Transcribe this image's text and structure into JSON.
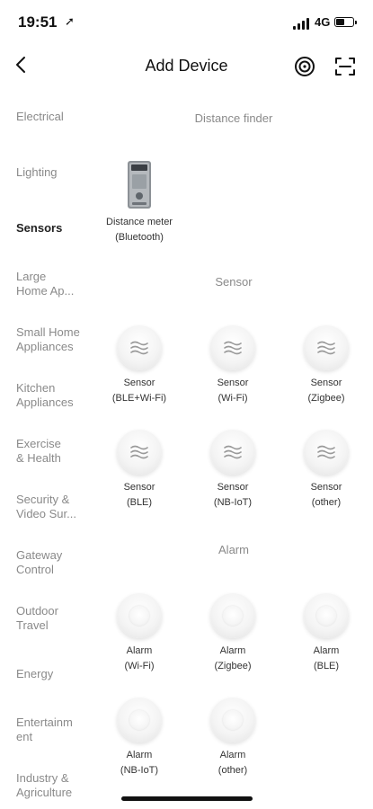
{
  "status_bar": {
    "time": "19:51",
    "network": "4G"
  },
  "header": {
    "title": "Add Device"
  },
  "sidebar": {
    "items": [
      {
        "line1": "Electrical",
        "line2": "",
        "active": false
      },
      {
        "line1": "Lighting",
        "line2": "",
        "active": false
      },
      {
        "line1": "Sensors",
        "line2": "",
        "active": true
      },
      {
        "line1": "Large",
        "line2": "Home Ap...",
        "active": false
      },
      {
        "line1": "Small Home",
        "line2": "Appliances",
        "active": false
      },
      {
        "line1": "Kitchen",
        "line2": "Appliances",
        "active": false
      },
      {
        "line1": "Exercise",
        "line2": "& Health",
        "active": false
      },
      {
        "line1": "Security &",
        "line2": "Video Sur...",
        "active": false
      },
      {
        "line1": "Gateway",
        "line2": "Control",
        "active": false
      },
      {
        "line1": "Outdoor",
        "line2": "Travel",
        "active": false
      },
      {
        "line1": "Energy",
        "line2": "",
        "active": false
      },
      {
        "line1": "Entertainm",
        "line2": "ent",
        "active": false
      },
      {
        "line1": "Industry &",
        "line2": "Agriculture",
        "active": false
      }
    ]
  },
  "sections": {
    "distance": {
      "title": "Distance finder",
      "items": [
        {
          "line1": "Distance meter",
          "line2": "(Bluetooth)",
          "icon": "distance-meter-device"
        }
      ]
    },
    "sensor": {
      "title": "Sensor",
      "items": [
        {
          "line1": "Sensor",
          "line2": "(BLE+Wi-Fi)",
          "icon": "wave-sensor"
        },
        {
          "line1": "Sensor",
          "line2": "(Wi-Fi)",
          "icon": "wave-sensor"
        },
        {
          "line1": "Sensor",
          "line2": "(Zigbee)",
          "icon": "wave-sensor"
        },
        {
          "line1": "Sensor",
          "line2": "(BLE)",
          "icon": "wave-sensor"
        },
        {
          "line1": "Sensor",
          "line2": "(NB-IoT)",
          "icon": "wave-sensor"
        },
        {
          "line1": "Sensor",
          "line2": "(other)",
          "icon": "wave-sensor"
        }
      ]
    },
    "alarm": {
      "title": "Alarm",
      "items": [
        {
          "line1": "Alarm",
          "line2": "(Wi-Fi)",
          "icon": "alarm-puck"
        },
        {
          "line1": "Alarm",
          "line2": "(Zigbee)",
          "icon": "alarm-puck"
        },
        {
          "line1": "Alarm",
          "line2": "(BLE)",
          "icon": "alarm-puck"
        },
        {
          "line1": "Alarm",
          "line2": "(NB-IoT)",
          "icon": "alarm-puck"
        },
        {
          "line1": "Alarm",
          "line2": "(other)",
          "icon": "alarm-puck"
        }
      ]
    }
  }
}
